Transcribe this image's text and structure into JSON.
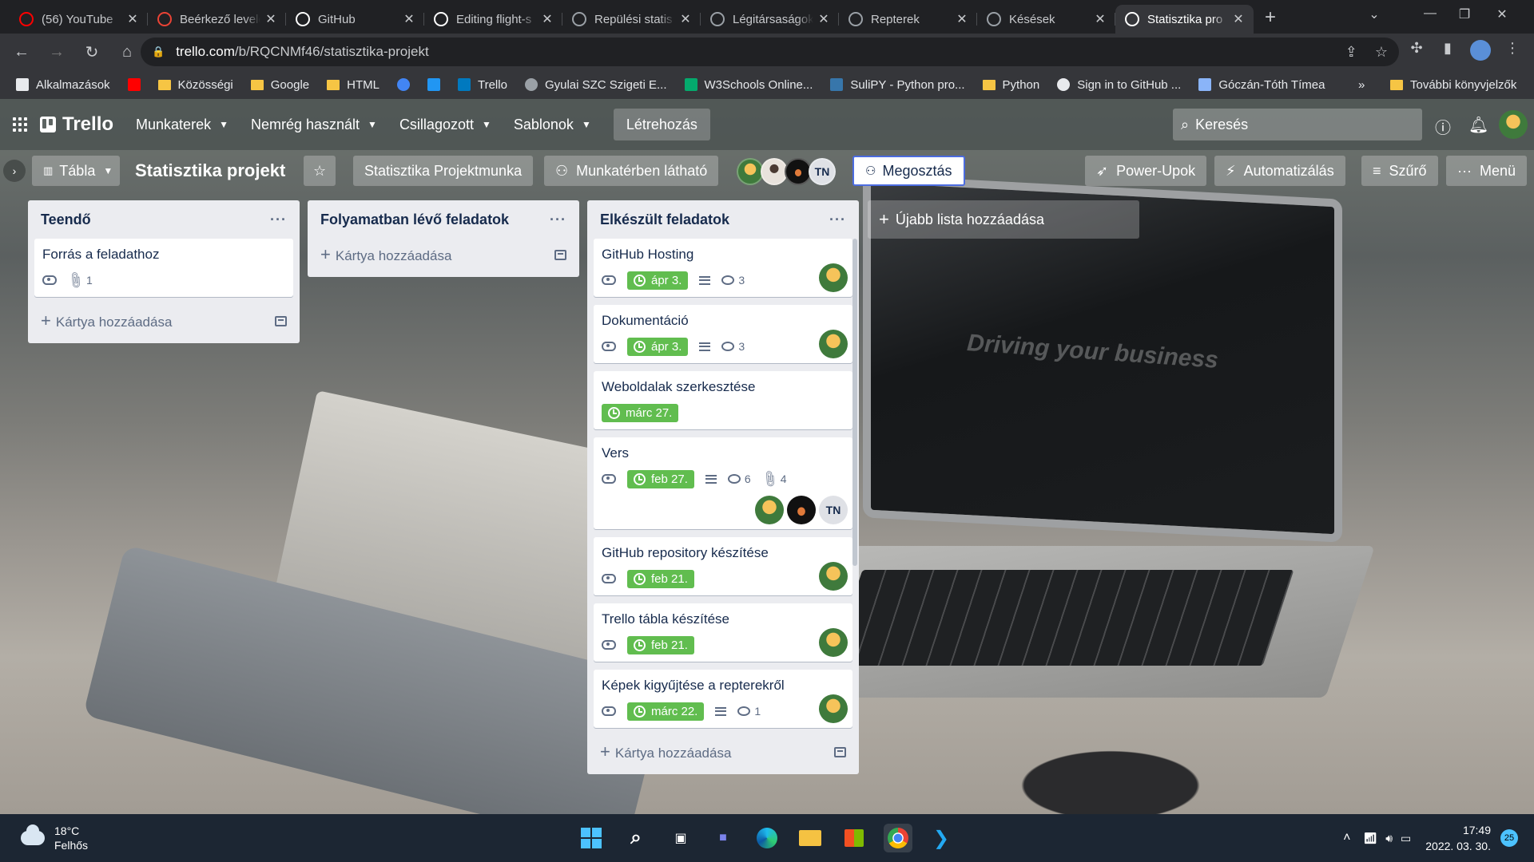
{
  "browser": {
    "tabs": [
      {
        "title": "(56) YouTube",
        "icon": "youtube-icon",
        "color": "#ff0000"
      },
      {
        "title": "Beérkező levelek",
        "icon": "gmail-icon",
        "color": "#ea4335"
      },
      {
        "title": "GitHub",
        "icon": "github-icon",
        "color": "#ffffff"
      },
      {
        "title": "Editing flight-s",
        "icon": "github-icon",
        "color": "#ffffff"
      },
      {
        "title": "Repülési statis",
        "icon": "globe-icon",
        "color": "#9aa0a6"
      },
      {
        "title": "Légitársaságok",
        "icon": "globe-icon",
        "color": "#9aa0a6"
      },
      {
        "title": "Repterek",
        "icon": "globe-icon",
        "color": "#9aa0a6"
      },
      {
        "title": "Késések",
        "icon": "globe-icon",
        "color": "#9aa0a6"
      },
      {
        "title": "Statisztika pro",
        "icon": "trello-icon",
        "color": "#ffffff",
        "active": true
      }
    ],
    "url_host": "trello.com",
    "url_path": "/b/RQCNMf46/statisztika-projekt",
    "bookmarks": [
      {
        "label": "Alkalmazások",
        "icon": "apps-grid-icon"
      },
      {
        "label": "",
        "icon": "youtube-icon"
      },
      {
        "label": "Közösségi",
        "icon": "folder-icon"
      },
      {
        "label": "Google",
        "icon": "folder-icon"
      },
      {
        "label": "HTML",
        "icon": "folder-icon"
      },
      {
        "label": "",
        "icon": "google-icon"
      },
      {
        "label": "",
        "icon": "k-icon"
      },
      {
        "label": "Trello",
        "icon": "trello-icon"
      },
      {
        "label": "Gyulai SZC Szigeti E...",
        "icon": "globe-icon"
      },
      {
        "label": "W3Schools Online...",
        "icon": "w3schools-icon"
      },
      {
        "label": "SuliPY - Python pro...",
        "icon": "python-icon"
      },
      {
        "label": "Python",
        "icon": "folder-icon"
      },
      {
        "label": "Sign in to GitHub ...",
        "icon": "github-icon"
      },
      {
        "label": "Góczán-Tóth Tímea",
        "icon": "bookmark-icon"
      }
    ],
    "more_bookmarks": "»",
    "other_bookmarks": "További könyvjelzők"
  },
  "trello_header": {
    "logo": "Trello",
    "menus": [
      "Munkaterek",
      "Nemrég használt",
      "Csillagozott",
      "Sablonok"
    ],
    "create": "Létrehozás",
    "search_placeholder": "Keresés"
  },
  "board_header": {
    "view": "Tábla",
    "title": "Statisztika projekt",
    "workspace": "Statisztika Projektmunka",
    "visibility": "Munkatérben látható",
    "member_initials": "TN",
    "share": "Megosztás",
    "powerups": "Power-Upok",
    "automation": "Automatizálás",
    "filter": "Szűrő",
    "menu": "Menü"
  },
  "lists": [
    {
      "title": "Teendő",
      "cards": [
        {
          "title": "Forrás a feladathoz",
          "watch": true,
          "attachments": "1"
        }
      ],
      "add_card": "Kártya hozzáadása"
    },
    {
      "title": "Folyamatban lévő feladatok",
      "cards": [],
      "add_card": "Kártya hozzáadása"
    },
    {
      "title": "Elkészült feladatok",
      "cards": [
        {
          "title": "GitHub Hosting",
          "watch": true,
          "due": "ápr 3.",
          "description": true,
          "comments": "3",
          "members": [
            "yellow"
          ]
        },
        {
          "title": "Dokumentáció",
          "watch": true,
          "due": "ápr 3.",
          "description": true,
          "comments": "3",
          "members": [
            "yellow"
          ]
        },
        {
          "title": "Weboldalak szerkesztése",
          "due": "márc 27."
        },
        {
          "title": "Vers",
          "watch": true,
          "due": "feb 27.",
          "description": true,
          "comments": "6",
          "attachments": "4",
          "members": [
            "yellow",
            "dark",
            "TN"
          ]
        },
        {
          "title": "GitHub repository készítése",
          "watch": true,
          "due": "feb 21.",
          "members": [
            "yellow"
          ]
        },
        {
          "title": "Trello tábla készítése",
          "watch": true,
          "due": "feb 21.",
          "members": [
            "yellow"
          ]
        },
        {
          "title": "Képek kigyűjtése a repterekről",
          "watch": true,
          "due": "márc 22.",
          "description": true,
          "comments": "1",
          "members": [
            "yellow"
          ]
        }
      ],
      "add_card": "Kártya hozzáadása"
    }
  ],
  "add_list": "Újabb lista hozzáadása",
  "background_text": "Driving your business",
  "taskbar": {
    "temperature": "18°C",
    "weather": "Felhős",
    "time": "17:49",
    "date": "2022. 03. 30.",
    "notifications": "25"
  },
  "colors": {
    "due_green": "#61bd4f",
    "list_bg": "#ebecf0",
    "share_border": "#4c6ce0"
  }
}
